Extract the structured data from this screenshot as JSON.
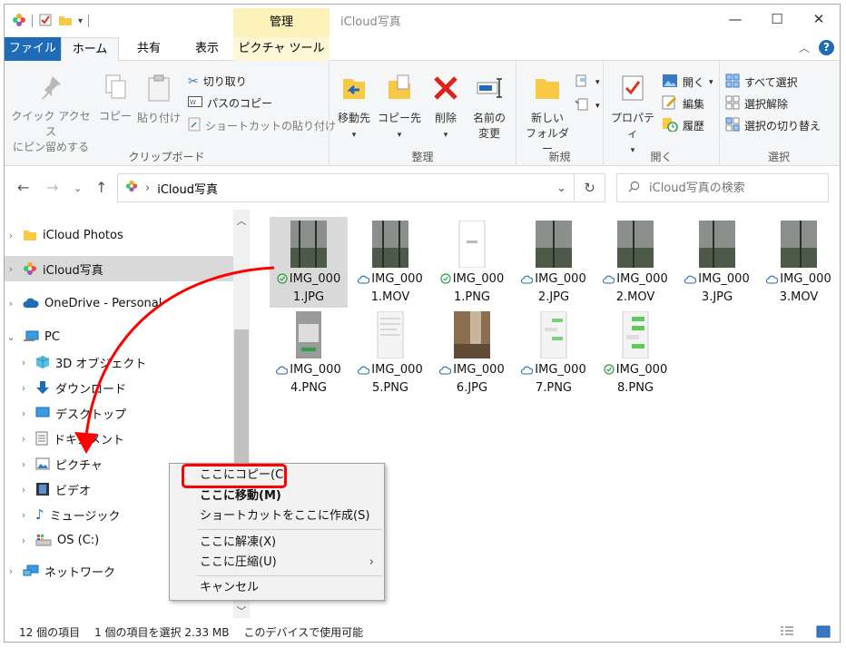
{
  "titlebar": {
    "context_tab": "管理",
    "title": "iCloud写真",
    "minimize": "—",
    "maximize": "☐",
    "close": "✕"
  },
  "ribbon_tabs": {
    "file": "ファイル",
    "home": "ホーム",
    "share": "共有",
    "view": "表示",
    "picture_tools": "ピクチャ ツール"
  },
  "clipboard": {
    "pin_line1": "クイック アクセス",
    "pin_line2": "にピン留めする",
    "copy": "コピー",
    "paste": "貼り付け",
    "cut": "切り取り",
    "copy_path": "パスのコピー",
    "paste_shortcut": "ショートカットの貼り付け",
    "label": "クリップボード"
  },
  "organize": {
    "move_to": "移動先",
    "copy_to": "コピー先",
    "delete": "削除",
    "rename_line1": "名前の",
    "rename_line2": "変更",
    "label": "整理"
  },
  "new_group": {
    "new_folder_line1": "新しい",
    "new_folder_line2": "フォルダー",
    "label": "新規"
  },
  "open_group": {
    "properties": "プロパティ",
    "open": "開く",
    "edit": "編集",
    "history": "履歴",
    "label": "開く"
  },
  "select_group": {
    "select_all": "すべて選択",
    "select_none": "選択解除",
    "invert": "選択の切り替え",
    "label": "選択"
  },
  "address": {
    "path": "iCloud写真",
    "search_placeholder": "iCloud写真の検索"
  },
  "nav": {
    "items": [
      {
        "label": "iCloud Photos"
      },
      {
        "label": "iCloud写真"
      },
      {
        "label": "OneDrive - Personal"
      },
      {
        "label": "PC"
      },
      {
        "label": "3D オブジェクト"
      },
      {
        "label": "ダウンロード"
      },
      {
        "label": "デスクトップ"
      },
      {
        "label": "ドキュメント"
      },
      {
        "label": "ピクチャ"
      },
      {
        "label": "ビデオ"
      },
      {
        "label": "ミュージック"
      },
      {
        "label": "OS (C:)"
      },
      {
        "label": "ネットワーク"
      }
    ]
  },
  "files": [
    {
      "line1": "IMG_000",
      "line2": "1.JPG",
      "status": "synced"
    },
    {
      "line1": "IMG_000",
      "line2": "1.MOV",
      "status": "cloud"
    },
    {
      "line1": "IMG_000",
      "line2": "1.PNG",
      "status": "synced"
    },
    {
      "line1": "IMG_000",
      "line2": "2.JPG",
      "status": "cloud"
    },
    {
      "line1": "IMG_000",
      "line2": "2.MOV",
      "status": "cloud"
    },
    {
      "line1": "IMG_000",
      "line2": "3.JPG",
      "status": "cloud"
    },
    {
      "line1": "IMG_000",
      "line2": "3.MOV",
      "status": "cloud"
    },
    {
      "line1": "IMG_000",
      "line2": "4.PNG",
      "status": "cloud"
    },
    {
      "line1": "IMG_000",
      "line2": "5.PNG",
      "status": "cloud"
    },
    {
      "line1": "IMG_000",
      "line2": "6.JPG",
      "status": "cloud"
    },
    {
      "line1": "IMG_000",
      "line2": "7.PNG",
      "status": "cloud"
    },
    {
      "line1": "IMG_000",
      "line2": "8.PNG",
      "status": "synced"
    }
  ],
  "status_bar": {
    "count": "12 個の項目",
    "selected": "1 個の項目を選択  2.33 MB",
    "availability": "このデバイスで使用可能"
  },
  "context_menu": {
    "copy_here": "ここにコピー(C)",
    "move_here": "ここに移動(M)",
    "shortcut_here": "ショートカットをここに作成(S)",
    "extract_here": "ここに解凍(X)",
    "compress_here": "ここに圧縮(U)",
    "cancel": "キャンセル"
  },
  "colors": {
    "accent": "#1e6bb8",
    "highlight": "#ff0000",
    "context_tab": "#fcf1b8",
    "synced": "#2e9e47",
    "cloud": "#1e6bb8"
  }
}
